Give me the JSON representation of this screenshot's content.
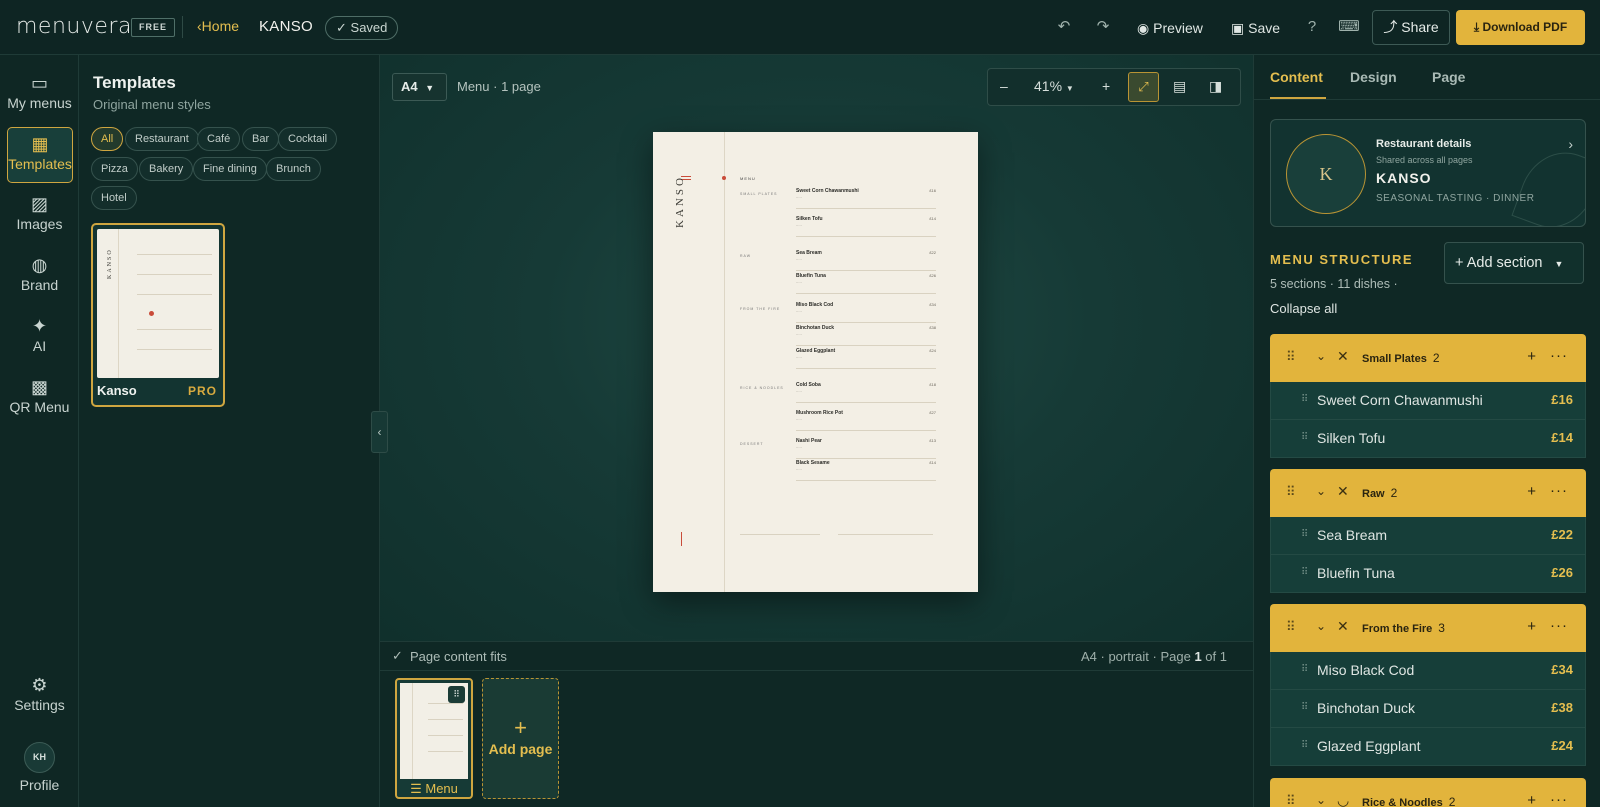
{
  "topbar": {
    "logo": "menuvera",
    "plan_badge": "FREE",
    "home_label": "Home",
    "menu_title": "KANSO",
    "saved_label": "Saved",
    "preview_label": "Preview",
    "save_label": "Save",
    "share_label": "Share",
    "download_label": "Download PDF",
    "icons": [
      "undo-icon",
      "redo-icon",
      "eye-icon",
      "save-icon",
      "help-icon",
      "keyboard-icon",
      "share-icon",
      "download-icon"
    ]
  },
  "leftnav": {
    "items": [
      {
        "label": "My menus",
        "icon": "book-icon"
      },
      {
        "label": "Templates",
        "icon": "layout-icon",
        "active": true
      },
      {
        "label": "Images",
        "icon": "image-icon"
      },
      {
        "label": "Brand",
        "icon": "palette-icon"
      },
      {
        "label": "AI",
        "icon": "sparkle-icon"
      },
      {
        "label": "QR Menu",
        "icon": "qr-icon"
      }
    ],
    "settings_label": "Settings",
    "profile_initials": "KH",
    "profile_label": "Profile"
  },
  "templates": {
    "title": "Templates",
    "subtitle": "Original menu styles",
    "filters": [
      "All",
      "Restaurant",
      "Café",
      "Bar",
      "Cocktail",
      "Pizza",
      "Bakery",
      "Fine dining",
      "Brunch",
      "Hotel"
    ],
    "active_filter": "All",
    "cards": [
      {
        "name": "Kanso",
        "tier": "PRO"
      }
    ]
  },
  "canvas": {
    "paper_size": "A4",
    "summary": "Menu · 1 page",
    "zoom_minus": "–",
    "zoom": "41%",
    "zoom_plus": "+",
    "preview": {
      "brand": "KANSO",
      "heading": "MENU",
      "sections": [
        {
          "name": "SMALL PLATES",
          "dishes": [
            {
              "name": "Sweet Corn Chawanmushi",
              "price": "£16"
            },
            {
              "name": "Silken Tofu",
              "price": "£14"
            }
          ]
        },
        {
          "name": "RAW",
          "dishes": [
            {
              "name": "Sea Bream",
              "price": "£22"
            },
            {
              "name": "Bluefin Tuna",
              "price": "£26"
            }
          ]
        },
        {
          "name": "FROM THE FIRE",
          "dishes": [
            {
              "name": "Miso Black Cod",
              "price": "£34"
            },
            {
              "name": "Binchotan Duck",
              "price": "£38"
            },
            {
              "name": "Glazed Eggplant",
              "price": "£24"
            }
          ]
        },
        {
          "name": "RICE & NOODLES",
          "dishes": [
            {
              "name": "Cold Soba",
              "price": "£18"
            },
            {
              "name": "Mushroom Rice Pot",
              "price": "£27"
            }
          ]
        },
        {
          "name": "DESSERT",
          "dishes": [
            {
              "name": "Nashi Pear",
              "price": "£13"
            },
            {
              "name": "Black Sesame",
              "price": "£14"
            }
          ]
        }
      ]
    }
  },
  "status": {
    "fits": "Page content fits",
    "page_info_prefix": "A4 · portrait · Page ",
    "page_current": "1",
    "page_info_mid": " of ",
    "page_total": "1"
  },
  "pages": {
    "thumb_label": "Menu",
    "add_label": "Add page"
  },
  "rightpanel": {
    "tabs": [
      "Content",
      "Design",
      "Page"
    ],
    "active_tab": "Content",
    "restaurant": {
      "initial": "K",
      "title": "Restaurant details",
      "subtitle": "Shared across all pages",
      "name": "KANSO",
      "tagline": "SEASONAL TASTING · DINNER"
    },
    "structure_title": "MENU STRUCTURE",
    "stats": "5 sections · 11 dishes ·",
    "collapse_label": "Collapse all",
    "add_section_label": "Add section",
    "sections": [
      {
        "name": "Small Plates",
        "count": "2",
        "icon": "utensils-icon",
        "dishes": [
          {
            "name": "Sweet Corn Chawanmushi",
            "price": "£16"
          },
          {
            "name": "Silken Tofu",
            "price": "£14"
          }
        ]
      },
      {
        "name": "Raw",
        "count": "2",
        "icon": "utensils-icon",
        "dishes": [
          {
            "name": "Sea Bream",
            "price": "£22"
          },
          {
            "name": "Bluefin Tuna",
            "price": "£26"
          }
        ]
      },
      {
        "name": "From the Fire",
        "count": "3",
        "icon": "utensils-icon",
        "dishes": [
          {
            "name": "Miso Black Cod",
            "price": "£34"
          },
          {
            "name": "Binchotan Duck",
            "price": "£38"
          },
          {
            "name": "Glazed Eggplant",
            "price": "£24"
          }
        ]
      },
      {
        "name": "Rice & Noodles",
        "count": "2",
        "icon": "bowl-icon",
        "dishes": []
      }
    ]
  },
  "colors": {
    "accent": "#e2b43c",
    "background": "#0f2a27",
    "panel": "#0f2825"
  }
}
